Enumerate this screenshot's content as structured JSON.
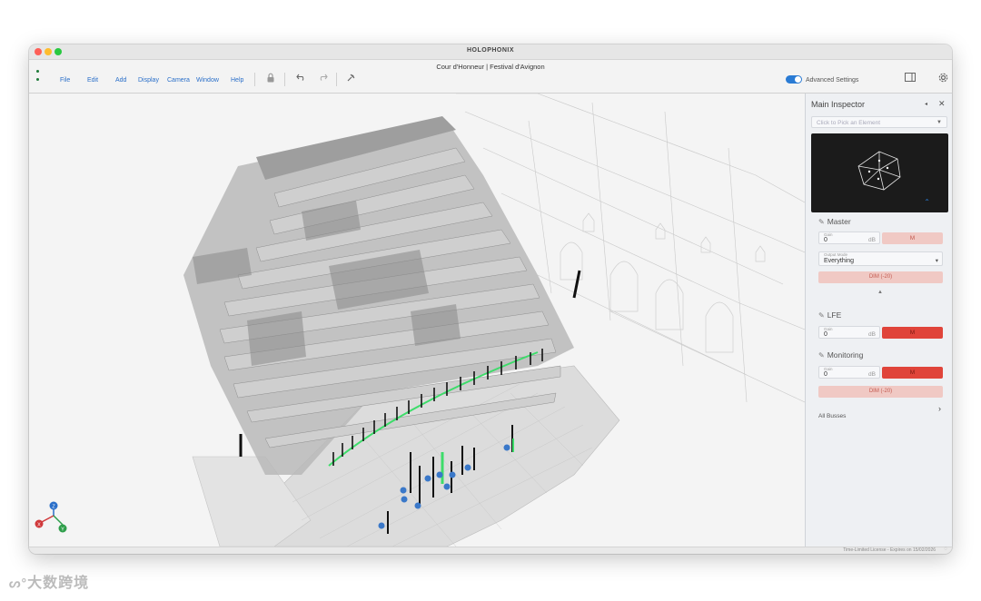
{
  "window": {
    "app_title": "HOLOPHONIX",
    "document_title": "Cour d'Honneur | Festival d'Avignon"
  },
  "menu": {
    "items": [
      "File",
      "Edit",
      "Add",
      "Display",
      "Camera",
      "Window",
      "Help"
    ]
  },
  "toolbar": {
    "lock_icon": "lock-icon",
    "undo_icon": "undo-arrow-icon",
    "redo_icon": "redo-arrow-icon",
    "tool_icon": "pin-tool-icon",
    "advanced_settings_label": "Advanced Settings",
    "advanced_settings_on": true,
    "panel_icon": "panel-toggle-icon",
    "settings_icon": "gear-icon"
  },
  "inspector": {
    "title": "Main Inspector",
    "picker_placeholder": "Click to Pick an Element",
    "master": {
      "title": "Master",
      "gain_label": "Gain",
      "gain_value": "0",
      "gain_unit": "dB",
      "mute_label": "M",
      "output_mode_label": "Output Mode",
      "output_mode_value": "Everything",
      "dim_label": "DIM (-20)"
    },
    "lfe": {
      "title": "LFE",
      "gain_label": "Gain",
      "gain_value": "0",
      "gain_unit": "dB",
      "mute_label": "M"
    },
    "monitoring": {
      "title": "Monitoring",
      "gain_label": "Gain",
      "gain_value": "0",
      "gain_unit": "dB",
      "mute_label": "M",
      "dim_label": "DIM (-20)"
    },
    "all_busses_label": "All Busses"
  },
  "axes": {
    "z": "Z",
    "x": "X",
    "y": "Y"
  },
  "colors": {
    "accent": "#2a7bd4",
    "mute_active": "#e0443a",
    "mute_inactive": "#f0c9c4",
    "speaker_green": "#3ddc6a",
    "source_blue": "#3a78c9"
  },
  "status": {
    "license": "Time-Limited License - Expires on 15/02/2026"
  },
  "watermark": "大数跨境"
}
